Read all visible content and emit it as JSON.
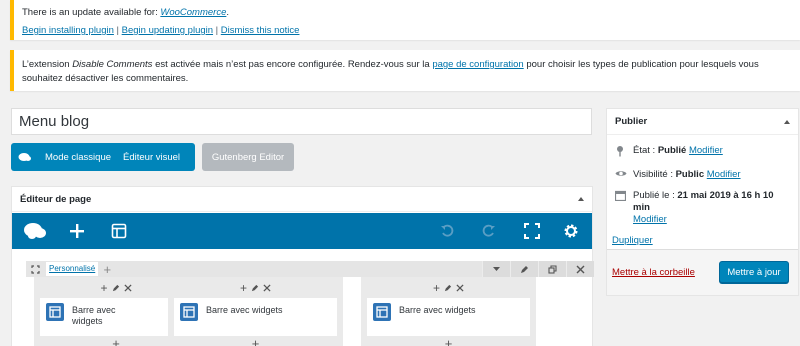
{
  "notices": {
    "update": {
      "prefix": "There is an update available for: ",
      "plugin": "WooCommerce",
      "suffix": ".",
      "link_install": "Begin installing plugin",
      "separator": " | ",
      "link_update": "Begin updating plugin",
      "link_dismiss": "Dismiss this notice"
    },
    "comments": {
      "text_before": "L’extension ",
      "plugin": "Disable Comments",
      "text_mid": " est activée mais n’est pas encore configurée. Rendez-vous sur la ",
      "link": "page de configuration",
      "text_after": " pour choisir les types de publication pour lesquels vous souhaitez désactiver les commentaires."
    }
  },
  "post": {
    "title": "Menu blog"
  },
  "editor_buttons": {
    "classic": "Mode classique",
    "visual": "Éditeur visuel",
    "gutenberg": "Gutenberg Editor"
  },
  "page_editor": {
    "title": "Éditeur de page",
    "row_style_label": "Personnalisé",
    "cells": [
      {
        "widget_title": "Barre avec widgets"
      },
      {
        "widget_title": "Barre avec widgets"
      },
      {
        "widget_title": "Barre avec widgets"
      }
    ]
  },
  "publish": {
    "title": "Publier",
    "status_label": "État :",
    "status_value": "Publié",
    "visibility_label": "Visibilité :",
    "visibility_value": "Public",
    "published_label": "Publié le :",
    "published_value": "21 mai 2019 à 16 h 10 min",
    "modify": "Modifier",
    "duplicate": "Dupliquer",
    "trash": "Mettre à la corbeille",
    "update_button": "Mettre à jour"
  },
  "colors": {
    "accent": "#0073aa",
    "primary_button": "#0085ba",
    "notice_border": "#ffb900",
    "trash": "#a00000"
  }
}
